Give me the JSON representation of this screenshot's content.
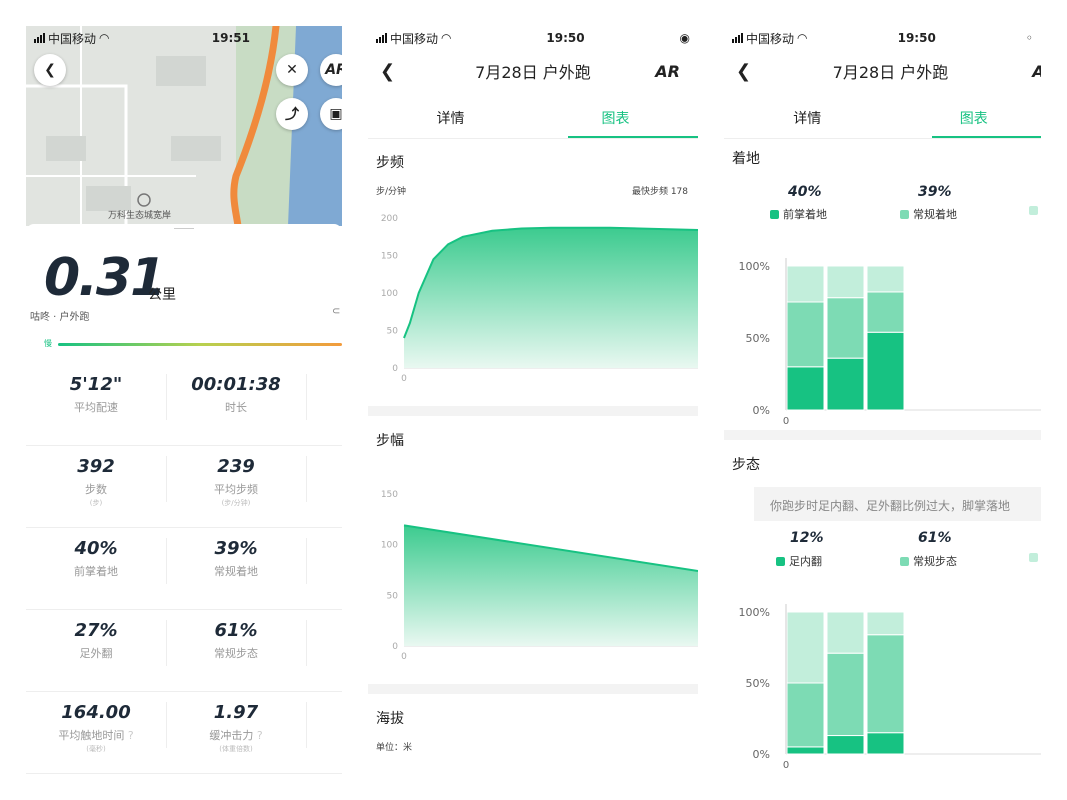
{
  "status": {
    "carrier": "中国移动",
    "time1": "19:51",
    "time2": "19:50",
    "time3": "19:50"
  },
  "screen1": {
    "map_label": "万科生态城宽岸",
    "ar_label": "AR",
    "distance": "0.31",
    "distance_unit": "公里",
    "subtitle": "咕咚 · 户外跑",
    "pace_marker": "慢",
    "stats": [
      {
        "value": "5'12\"",
        "label": "平均配速",
        "unit": ""
      },
      {
        "value": "00:01:38",
        "label": "时长",
        "unit": ""
      },
      {
        "value": "392",
        "label": "步数",
        "unit": "(步)"
      },
      {
        "value": "239",
        "label": "平均步频",
        "unit": "(步/分钟)"
      },
      {
        "value": "40%",
        "label": "前掌着地",
        "unit": ""
      },
      {
        "value": "39%",
        "label": "常规着地",
        "unit": ""
      },
      {
        "value": "27%",
        "label": "足外翻",
        "unit": ""
      },
      {
        "value": "61%",
        "label": "常规步态",
        "unit": ""
      },
      {
        "value": "164.00",
        "label": "平均触地时间",
        "unit": "(毫秒)"
      },
      {
        "value": "1.97",
        "label": "缓冲击力",
        "unit": "(体重倍数)"
      }
    ],
    "progress_fraction": 1.0
  },
  "screen2": {
    "title": "7月28日 户外跑",
    "ar_label": "AR",
    "tab_detail": "详情",
    "tab_chart": "图表",
    "cadence_title": "步频",
    "cadence_unit": "步/分钟",
    "cadence_max_label": "最快步频 178",
    "stride_title": "步幅",
    "altitude_title": "海拔",
    "altitude_unit": "单位：米"
  },
  "screen3": {
    "title": "7月28日 户外跑",
    "ar_label": "AR",
    "tab_detail": "详情",
    "tab_chart": "图表",
    "landing_title": "着地",
    "landing_legend": [
      {
        "pct": "40%",
        "label": "前掌着地"
      },
      {
        "pct": "39%",
        "label": "常规着地"
      }
    ],
    "gait_title": "步态",
    "gait_message": "你跑步时足内翻、足外翻比例过大，脚掌落地",
    "gait_legend": [
      {
        "pct": "12%",
        "label": "足内翻"
      },
      {
        "pct": "61%",
        "label": "常规步态"
      }
    ]
  },
  "colors": {
    "accent": "#17c282",
    "mid": "#7ddbb4",
    "light": "#c2eedb",
    "route": "#f08a3c"
  },
  "chart_data": [
    {
      "type": "area",
      "title": "步频",
      "ylabel": "步/分钟",
      "ylim": [
        0,
        200
      ],
      "yticks": [
        0,
        50,
        100,
        150,
        200
      ],
      "xticks": [
        "0"
      ],
      "x": [
        0,
        2,
        5,
        10,
        15,
        20,
        30,
        40,
        50,
        60,
        70,
        80,
        90,
        100
      ],
      "series": [
        {
          "values": [
            40,
            60,
            100,
            145,
            165,
            175,
            183,
            186,
            187,
            187,
            187,
            186,
            185,
            184
          ]
        }
      ]
    },
    {
      "type": "area",
      "title": "步幅",
      "ylim": [
        0,
        150
      ],
      "yticks": [
        0,
        50,
        100,
        150
      ],
      "xticks": [
        "0"
      ],
      "x": [
        0,
        100
      ],
      "series": [
        {
          "values": [
            119,
            74
          ]
        }
      ]
    },
    {
      "type": "bar",
      "title": "着地",
      "stacked": true,
      "yticks": [
        "0%",
        "50%",
        "100%"
      ],
      "xticks": [
        "0"
      ],
      "categories": [
        "1",
        "2",
        "3"
      ],
      "series": [
        {
          "name": "前掌着地",
          "values": [
            30,
            36,
            54
          ]
        },
        {
          "name": "常规着地",
          "values": [
            45,
            42,
            28
          ]
        },
        {
          "values": [
            25,
            22,
            18
          ]
        }
      ]
    },
    {
      "type": "bar",
      "title": "步态",
      "stacked": true,
      "yticks": [
        "0%",
        "50%",
        "100%"
      ],
      "xticks": [
        "0"
      ],
      "categories": [
        "1",
        "2",
        "3"
      ],
      "series": [
        {
          "name": "足内翻",
          "values": [
            5,
            13,
            15
          ]
        },
        {
          "name": "常规步态",
          "values": [
            45,
            58,
            69
          ]
        },
        {
          "values": [
            50,
            29,
            16
          ]
        }
      ]
    }
  ]
}
